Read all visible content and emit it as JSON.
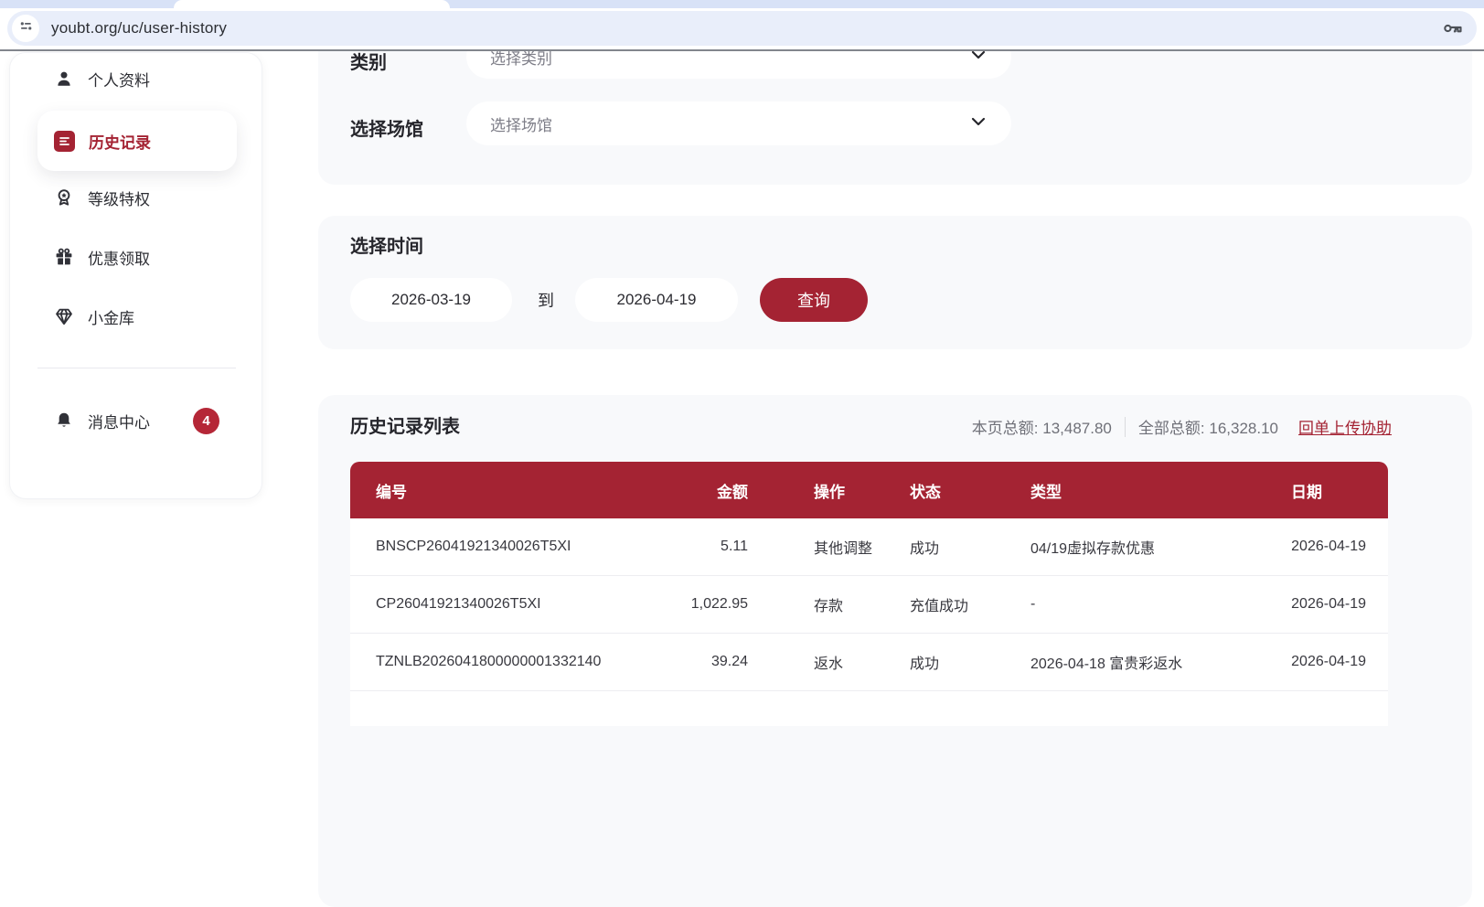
{
  "browser": {
    "url": "youbt.org/uc/user-history"
  },
  "colors": {
    "brand_red": "#a42333",
    "badge_red": "#b52737",
    "card_bg": "#f8f9fb",
    "omnibox_bg": "#e9eefa"
  },
  "sidebar": {
    "items": [
      {
        "label": "个人资料",
        "icon": "person-icon",
        "active": false
      },
      {
        "label": "历史记录",
        "icon": "document-icon",
        "active": true
      },
      {
        "label": "等级特权",
        "icon": "medal-icon",
        "active": false
      },
      {
        "label": "优惠领取",
        "icon": "gift-icon",
        "active": false
      },
      {
        "label": "小金库",
        "icon": "gem-icon",
        "active": false
      }
    ],
    "message_center": {
      "label": "消息中心",
      "icon": "bell-icon",
      "badge": "4"
    }
  },
  "filters": {
    "category_label": "类别",
    "category_placeholder": "选择类别",
    "venue_label": "选择场馆",
    "venue_placeholder": "选择场馆"
  },
  "time": {
    "title": "选择时间",
    "from_date": "2026-03-19",
    "to_word": "到",
    "to_date": "2026-04-19",
    "search_label": "查询"
  },
  "history": {
    "title": "历史记录列表",
    "page_total_label": "本页总额:",
    "page_total": "13,487.80",
    "all_total_label": "全部总额:",
    "all_total": "16,328.10",
    "upload_link": "回单上传协助",
    "columns": [
      "编号",
      "金额",
      "操作",
      "状态",
      "类型",
      "日期"
    ],
    "rows": [
      {
        "id": "BNSCP26041921340026T5XI",
        "amount": "5.11",
        "action": "其他调整",
        "status": "成功",
        "type": "04/19虚拟存款优惠",
        "date": "2026-04-19"
      },
      {
        "id": "CP26041921340026T5XI",
        "amount": "1,022.95",
        "action": "存款",
        "status": "充值成功",
        "type": "-",
        "date": "2026-04-19"
      },
      {
        "id": "TZNLB2026041800000001332140",
        "amount": "39.24",
        "action": "返水",
        "status": "成功",
        "type": "2026-04-18 富贵彩返水",
        "date": "2026-04-19"
      }
    ]
  }
}
